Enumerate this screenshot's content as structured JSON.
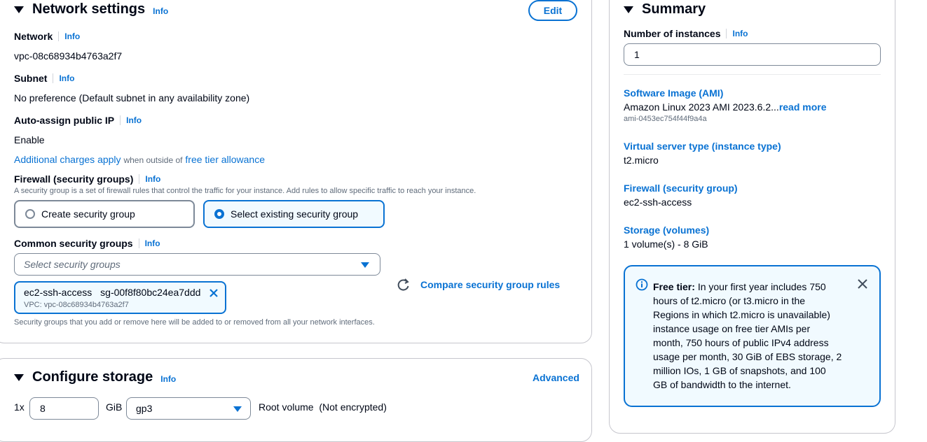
{
  "network": {
    "title": "Network settings",
    "info": "Info",
    "edit_label": "Edit",
    "network_label": "Network",
    "network_value": "vpc-08c68934b4763a2f7",
    "subnet_label": "Subnet",
    "subnet_value": "No preference (Default subnet in any availability zone)",
    "auto_ip_label": "Auto-assign public IP",
    "auto_ip_value": "Enable",
    "charges_link": "Additional charges apply",
    "charges_middle": "when outside of",
    "free_tier_link": "free tier allowance",
    "firewall_label": "Firewall (security groups)",
    "firewall_desc": "A security group is a set of firewall rules that control the traffic for your instance. Add rules to allow specific traffic to reach your instance.",
    "radio_create": "Create security group",
    "radio_select": "Select existing security group",
    "common_sg_label": "Common security groups",
    "select_placeholder": "Select security groups",
    "compare_label": "Compare security group rules",
    "token_name": "ec2-ssh-access",
    "token_id": "sg-00f8f80bc24ea7ddd",
    "token_vpc": "VPC: vpc-08c68934b4763a2f7",
    "sg_note": "Security groups that you add or remove here will be added to or removed from all your network interfaces."
  },
  "storage": {
    "title": "Configure storage",
    "info": "Info",
    "advanced_label": "Advanced",
    "count_prefix": "1x",
    "size_value": "8",
    "unit": "GiB",
    "volume_type": "gp3",
    "root_label": "Root volume  (Not encrypted)"
  },
  "summary": {
    "title": "Summary",
    "num_instances_label": "Number of instances",
    "info": "Info",
    "num_instances_value": "1",
    "ami_label": "Software Image (AMI)",
    "ami_value": "Amazon Linux 2023 AMI 2023.6.2...",
    "ami_read_more": "read more",
    "ami_id": "ami-0453ec754f44f9a4a",
    "instance_type_label": "Virtual server type (instance type)",
    "instance_type_value": "t2.micro",
    "firewall_label": "Firewall (security group)",
    "firewall_value": "ec2-ssh-access",
    "storage_label": "Storage (volumes)",
    "storage_value": "1 volume(s) - 8 GiB",
    "free_tier_title": "Free tier:",
    "free_tier_text": "In your first year includes 750 hours of t2.micro (or t3.micro in the Regions in which t2.micro is unavailable) instance usage on free tier AMIs per month, 750 hours of public IPv4 address usage per month, 30 GiB of EBS storage, 2 million IOs, 1 GB of snapshots, and 100 GB of bandwidth to the internet."
  }
}
